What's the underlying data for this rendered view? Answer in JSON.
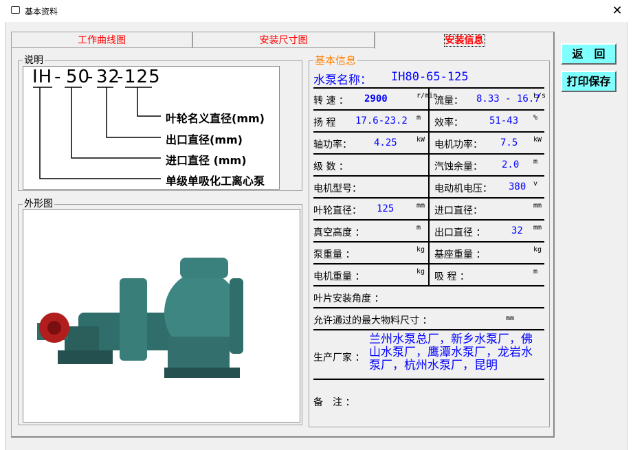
{
  "window": {
    "title": "基本资料",
    "close": "✕"
  },
  "tabs": [
    {
      "label": "工作曲线图"
    },
    {
      "label": "安装尺寸图"
    },
    {
      "label": "安装信息",
      "active": true
    }
  ],
  "buttons": {
    "back": "返　回",
    "print_save": "打印保存"
  },
  "description": {
    "group_label": "说明",
    "code_parts": [
      "IH",
      "-",
      "50",
      "-",
      "32",
      "-",
      "125"
    ],
    "explanations": [
      "叶轮名义直径(mm)",
      "出口直径(mm)",
      "进口直径 (mm)",
      "单级单吸化工离心泵"
    ]
  },
  "appearance": {
    "group_label": "外形图",
    "image": "pump-photo"
  },
  "info": {
    "group_label": "基本信息",
    "pump_name_label": "水泵名称：",
    "pump_name": "IH80-65-125",
    "rows": [
      {
        "l": {
          "label": "转 速 ：",
          "value": "2900",
          "unit": "r/min"
        },
        "r": {
          "label": "流量：",
          "value": "8.33 - 16.7",
          "unit": "L/s"
        }
      },
      {
        "l": {
          "label": "扬 程",
          "value": "17.6-23.2",
          "unit": "m"
        },
        "r": {
          "label": "效率：",
          "value": "51-43",
          "unit": "%"
        }
      },
      {
        "l": {
          "label": "轴功率：",
          "value": "4.25",
          "unit": "kW"
        },
        "r": {
          "label": "电机功率：",
          "value": "7.5",
          "unit": "kW"
        }
      },
      {
        "l": {
          "label": "级 数 ：",
          "value": "",
          "unit": ""
        },
        "r": {
          "label": "汽蚀余量：",
          "value": "2.0",
          "unit": "m"
        }
      },
      {
        "l": {
          "label": "电机型号：",
          "value": "",
          "unit": ""
        },
        "r": {
          "label": "电动机电压：",
          "value": "380",
          "unit": "v"
        }
      },
      {
        "l": {
          "label": "叶轮直径：",
          "value": "125",
          "unit": "mm"
        },
        "r": {
          "label": "进口直径：",
          "value": "",
          "unit": "mm"
        }
      },
      {
        "l": {
          "label": "真空高度 ：",
          "value": "",
          "unit": "m"
        },
        "r": {
          "label": "出口直径 ：",
          "value": "32",
          "unit": "mm"
        }
      },
      {
        "l": {
          "label": "泵重量 ：",
          "value": "",
          "unit": "kg"
        },
        "r": {
          "label": "基座重量 ：",
          "value": "",
          "unit": "kg"
        }
      },
      {
        "l": {
          "label": "电机重量 ：",
          "value": "",
          "unit": "kg"
        },
        "r": {
          "label": "吸 程 ：",
          "value": "",
          "unit": "m"
        }
      }
    ],
    "blade_angle_label": "叶片安装角度 ：",
    "max_material_label": "允许通过的最大物料尺寸 ：",
    "max_material_unit": "mm",
    "manufacturer_label": "生产厂家 ：",
    "manufacturer": "兰州水泵总厂，新乡水泵厂，佛山水泵厂，鹰潭水泵厂，龙岩水泵厂，杭州水泵厂，昆明",
    "remark_label": "备　注 ："
  },
  "colors": {
    "tab_text": "#ff0000",
    "value_text": "#0000ff",
    "group_title": "#ff8000",
    "button_bg": "#80ffff"
  }
}
